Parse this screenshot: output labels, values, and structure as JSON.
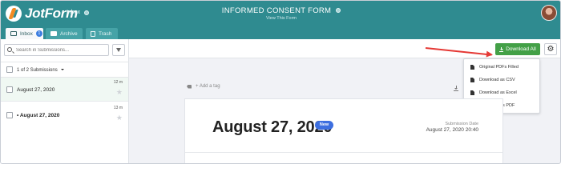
{
  "header": {
    "logo_text": "JotForm",
    "inbox_label": "Inbox",
    "form_title": "INFORMED CONSENT FORM",
    "view_form_link": "View This Form"
  },
  "tabs": [
    {
      "label": "Inbox",
      "badge": "1",
      "icon": "envelope-icon",
      "active": true
    },
    {
      "label": "Archive",
      "icon": "archive-icon",
      "active": false
    },
    {
      "label": "Trash",
      "icon": "trash-icon",
      "active": false
    }
  ],
  "sidebar": {
    "search_placeholder": "Search in Submissions...",
    "selection_text": "1 of 2 Submissions",
    "submissions": [
      {
        "date": "August 27, 2020",
        "time": "12 m",
        "selected": true,
        "unread": false
      },
      {
        "date": "August 27, 2020",
        "time": "13 m",
        "selected": false,
        "unread": true,
        "prefix": "•"
      }
    ]
  },
  "toolbar": {
    "download_all_label": "Download All"
  },
  "download_menu": {
    "items": [
      "Original PDFs Filled",
      "Download as CSV",
      "Download as Excel",
      "Download as PDF"
    ]
  },
  "main": {
    "add_tag_label": "+ Add a tag",
    "card_title": "August 27, 2020",
    "new_badge": "New",
    "submission_date_label": "Submission Date",
    "submission_date_value": "August 27, 2020 20:40"
  },
  "colors": {
    "header_bg": "#2f8b90",
    "download_button": "#43a047",
    "arrow": "#e53935",
    "new_badge": "#3d6fe0"
  }
}
